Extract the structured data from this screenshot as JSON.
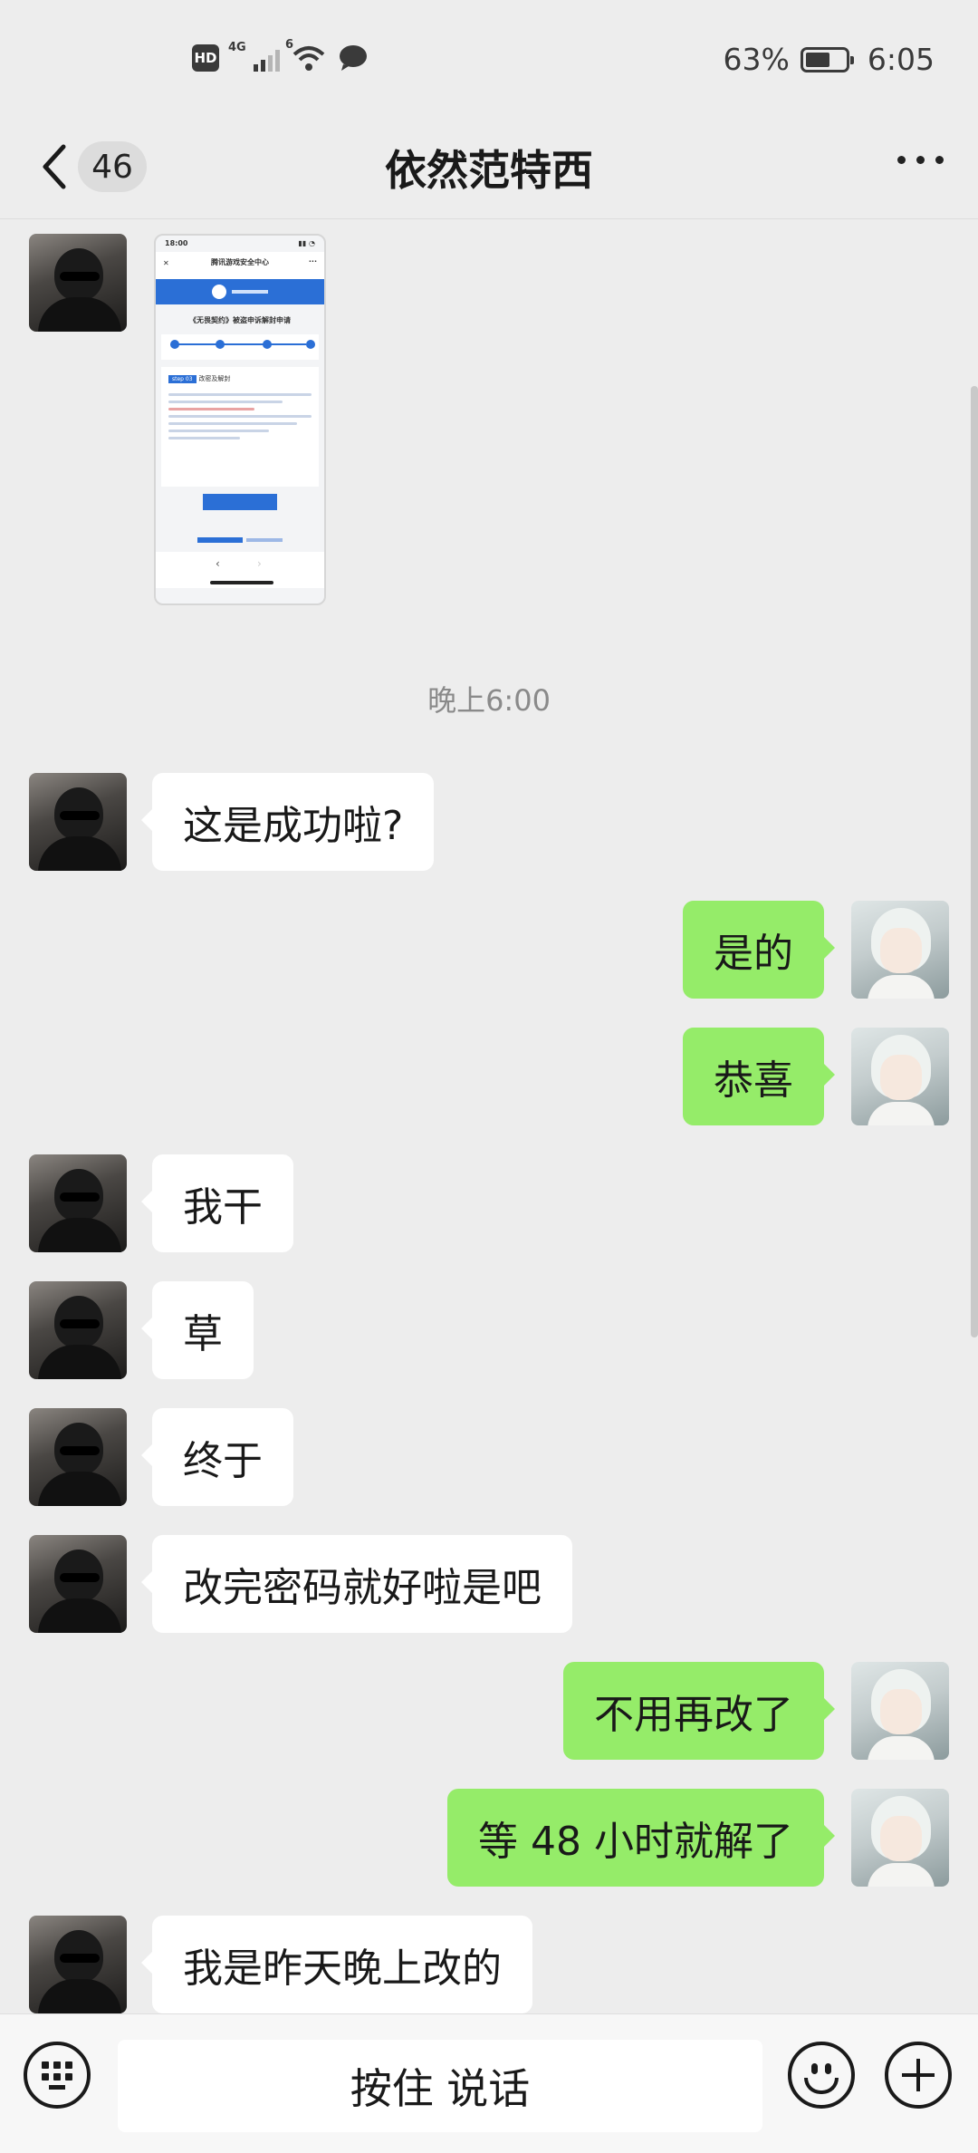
{
  "status_bar": {
    "hd_label": "HD",
    "network_label": "4G",
    "wifi_label": "6",
    "battery_percent": "63%",
    "battery_level": 0.63,
    "time": "6:05"
  },
  "header": {
    "unread_count": "46",
    "title": "依然范特西"
  },
  "timestamp": "晚上6:00",
  "messages": [
    {
      "side": "left",
      "text": "这是成功啦?"
    },
    {
      "side": "right",
      "text": "是的"
    },
    {
      "side": "right",
      "text": "恭喜"
    },
    {
      "side": "left",
      "text": "我干"
    },
    {
      "side": "left",
      "text": "草"
    },
    {
      "side": "left",
      "text": "终于"
    },
    {
      "side": "left",
      "text": "改完密码就好啦是吧"
    },
    {
      "side": "right",
      "text": "不用再改了"
    },
    {
      "side": "right",
      "text": "等 48 小时就解了"
    },
    {
      "side": "left",
      "text": "我是昨天晚上改的"
    }
  ],
  "screenshot_message": {
    "status_time": "18:00",
    "page_title": "腾讯游戏安全中心",
    "heading": "《无畏契约》被盗申诉解封申请",
    "step_tag": "step 03",
    "step_title": "改密及解封"
  },
  "bottom_bar": {
    "voice_label": "按住 说话"
  },
  "icons": {
    "back": "chevron-left-icon",
    "more": "more-dots-icon",
    "keyboard": "keyboard-icon",
    "emoji": "emoji-icon",
    "plus": "plus-icon"
  },
  "colors": {
    "background": "#ededed",
    "my_bubble": "#95ec69",
    "friend_bubble": "#ffffff"
  }
}
